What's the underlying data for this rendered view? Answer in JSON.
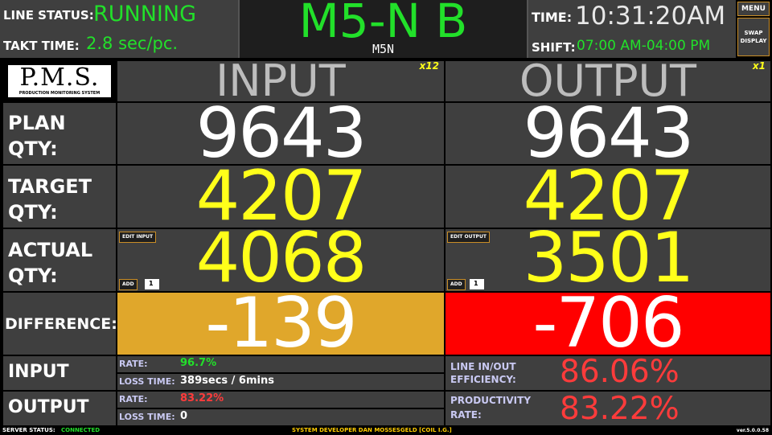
{
  "header": {
    "line_status_label": "LINE STATUS:",
    "line_status_value": "RUNNING",
    "takt_time_label": "TAKT TIME:",
    "takt_time_value": "2.8 sec/pc.",
    "line_name": "M5-N B",
    "line_code": "M5N",
    "time_label": "TIME:",
    "time_value": "10:31:20AM",
    "shift_label": "SHIFT:",
    "shift_value": "07:00 AM-04:00 PM",
    "menu_label": "MENU",
    "swap_line1": "SWAP",
    "swap_line2": "DISPLAY"
  },
  "logo": {
    "title": "P.M.S.",
    "subtitle": "PRODUCTION MONITORING SYSTEM"
  },
  "columns": {
    "input": {
      "title": "INPUT",
      "multiplier": "x12"
    },
    "output": {
      "title": "OUTPUT",
      "multiplier": "x1"
    }
  },
  "rows": {
    "plan": {
      "line1": "PLAN",
      "line2": "QTY:",
      "input": "9643",
      "output": "9643"
    },
    "target": {
      "line1": "TARGET",
      "line2": "QTY:",
      "input": "4207",
      "output": "4207"
    },
    "actual": {
      "line1": "ACTUAL",
      "line2": "QTY:",
      "input": "4068",
      "output": "3501",
      "edit_input_label": "EDIT INPUT",
      "edit_output_label": "EDIT OUTPUT",
      "add_label": "ADD",
      "add_input_value": "1",
      "add_output_value": "1"
    },
    "difference": {
      "label": "DIFFERENCE:",
      "input": "-139",
      "output": "-706"
    }
  },
  "stats": {
    "input_label": "INPUT",
    "output_label": "OUTPUT",
    "rate_label": "RATE:",
    "loss_time_label": "LOSS TIME:",
    "input_rate": "96.7%",
    "input_loss_time": "389secs / 6mins",
    "output_rate": "83.22%",
    "output_loss_time": "0",
    "efficiency_label_1": "LINE IN/OUT",
    "efficiency_label_2": "EFFICIENCY:",
    "efficiency_value": "86.06%",
    "productivity_label_1": "PRODUCTIVITY",
    "productivity_label_2": "RATE:",
    "productivity_value": "83.22%"
  },
  "footer": {
    "server_status_label": "SERVER STATUS:",
    "server_status_value": "CONNECTED",
    "developer": "SYSTEM DEVELOPER   DAN  MOSSESGELD [COIL I.G.]",
    "version": "ver.5.0.0.58"
  },
  "colors": {
    "running": "#22e02a",
    "target_actual": "#ffff1a",
    "diff_input_bg": "#e0a72b",
    "diff_output_bg": "#ff0000",
    "bad_value": "#ff3b3b",
    "panel_bg": "#3f3f3f"
  }
}
